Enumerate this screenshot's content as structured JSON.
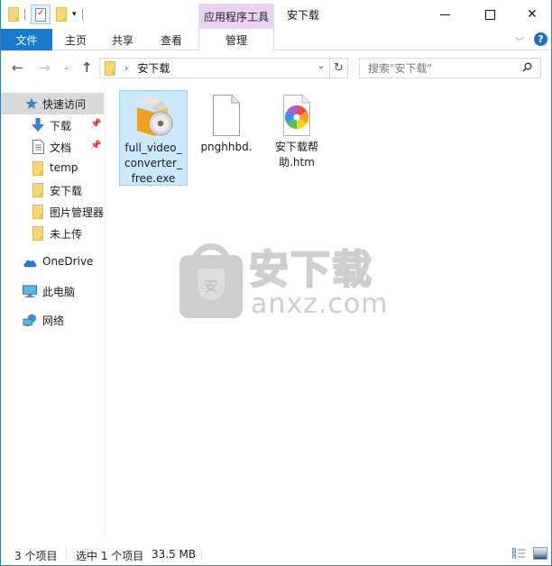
{
  "window": {
    "title": "安下载",
    "context_tool_group": "应用程序工具"
  },
  "ribbon": {
    "tabs": [
      {
        "label": "文件",
        "active": true
      },
      {
        "label": "主页"
      },
      {
        "label": "共享"
      },
      {
        "label": "查看"
      },
      {
        "label": "管理"
      }
    ],
    "help": "?"
  },
  "navigation": {
    "back": "←",
    "forward": "→",
    "recent": "⌄",
    "up": "↑",
    "address": {
      "separator": "›",
      "path": "安下载"
    },
    "refresh": "↻",
    "search": {
      "placeholder": "搜索\"安下载\""
    }
  },
  "sidebar": {
    "quick_access": {
      "label": "快速访问",
      "active": true
    },
    "pinned": [
      {
        "label": "下载",
        "icon": "download-arrow-icon",
        "pinned": true
      },
      {
        "label": "文档",
        "icon": "document-icon",
        "pinned": true
      }
    ],
    "folders": [
      {
        "label": "temp"
      },
      {
        "label": "安下载"
      },
      {
        "label": "图片管理器"
      },
      {
        "label": "未上传"
      }
    ],
    "onedrive": {
      "label": "OneDrive"
    },
    "this_pc": {
      "label": "此电脑"
    },
    "network": {
      "label": "网络"
    },
    "pin_glyph": "📌"
  },
  "files": [
    {
      "name": "full_video_converter_free.exe",
      "display": "full_video_\nconverter_\nfree.exe",
      "type": "installer",
      "selected": true
    },
    {
      "name": "pnghhbd.",
      "display": "pnghhbd.",
      "type": "blank-file",
      "selected": false
    },
    {
      "name": "安下载帮助.htm",
      "display": "安下载帮\n助.htm",
      "type": "html-file",
      "selected": false
    }
  ],
  "watermark": {
    "cn": "安下载",
    "en": "anxz.com",
    "badge": "安"
  },
  "status": {
    "item_count": "3 个项目",
    "selected": "选中 1 个项目",
    "size": "33.5 MB"
  },
  "colors": {
    "accent": "#1979ca",
    "context_tab": "#ead3f2",
    "selection_bg": "#cce8ff",
    "selection_border": "#99d1ff",
    "window_border": "#3c7ea7"
  }
}
